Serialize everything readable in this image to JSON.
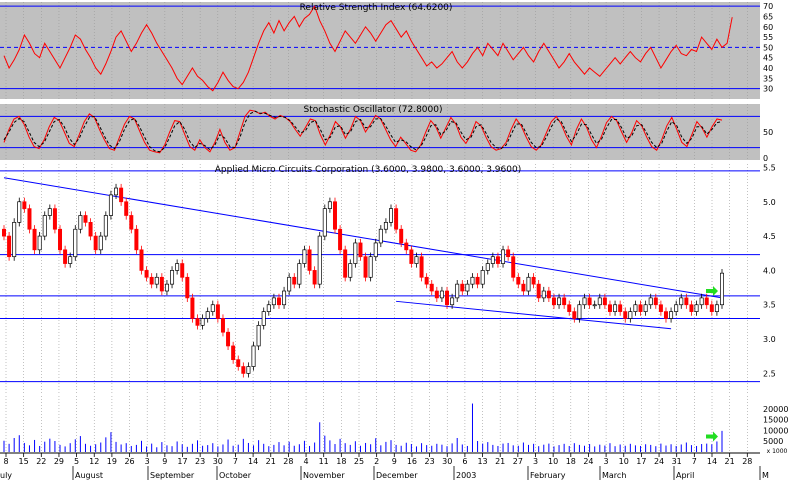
{
  "colors": {
    "background": "#ffffff",
    "rsi_panel_bg": "#c0c0c0",
    "stoch_panel_bg": "#c0c0c0",
    "blue_line": "#0000ff",
    "red": "#ff0000",
    "black": "#000000",
    "green_arrow": "#22dd22",
    "grid": "#999999",
    "volume_bar": "#0000ff"
  },
  "chart_data": [
    {
      "type": "line",
      "title": "Relative Strength Index (64.6200)",
      "ylim": [
        25,
        72
      ],
      "y_ticks": [
        "70",
        "65",
        "60",
        "55",
        "50",
        "45",
        "40",
        "35",
        "30"
      ],
      "y_tick_values": [
        70,
        65,
        60,
        55,
        50,
        45,
        40,
        35,
        30
      ],
      "reference_lines": [
        70,
        50,
        30
      ],
      "series": [
        {
          "color": "red",
          "values": [
            46,
            40,
            44,
            49,
            56,
            52,
            47,
            45,
            52,
            48,
            44,
            40,
            45,
            50,
            56,
            54,
            49,
            45,
            40,
            37,
            42,
            48,
            55,
            58,
            53,
            48,
            52,
            57,
            61,
            57,
            52,
            48,
            44,
            40,
            35,
            32,
            36,
            40,
            36,
            34,
            31,
            29,
            33,
            38,
            34,
            31,
            30,
            33,
            38,
            45,
            52,
            58,
            62,
            57,
            63,
            58,
            62,
            65,
            60,
            64,
            66,
            70,
            63,
            58,
            52,
            48,
            53,
            58,
            55,
            52,
            56,
            60,
            57,
            53,
            57,
            61,
            63,
            59,
            55,
            58,
            53,
            49,
            45,
            41,
            43,
            40,
            42,
            45,
            48,
            43,
            40,
            43,
            47,
            50,
            46,
            52,
            49,
            46,
            52,
            48,
            44,
            47,
            50,
            46,
            43,
            48,
            52,
            48,
            44,
            40,
            43,
            47,
            43,
            40,
            37,
            40,
            38,
            36,
            39,
            42,
            45,
            42,
            45,
            48,
            45,
            43,
            47,
            50,
            45,
            40,
            44,
            48,
            51,
            47,
            46,
            49,
            48,
            55,
            52,
            49,
            54,
            50,
            52,
            64.62
          ]
        }
      ]
    },
    {
      "type": "line",
      "title": "Stochastic Oscillator (72.8000)",
      "ylim": [
        0,
        100
      ],
      "y_ticks": [
        "50",
        "0"
      ],
      "y_tick_values": [
        50,
        0
      ],
      "reference_lines": [
        80,
        20
      ],
      "series": [
        {
          "color": "red",
          "values": [
            30,
            55,
            75,
            80,
            65,
            40,
            22,
            18,
            35,
            60,
            78,
            72,
            50,
            28,
            22,
            45,
            70,
            85,
            78,
            55,
            35,
            18,
            15,
            40,
            65,
            80,
            75,
            52,
            30,
            15,
            12,
            10,
            25,
            50,
            72,
            70,
            45,
            22,
            15,
            35,
            20,
            12,
            30,
            55,
            30,
            15,
            20,
            50,
            80,
            92,
            90,
            85,
            88,
            80,
            75,
            82,
            78,
            70,
            55,
            42,
            58,
            75,
            72,
            45,
            25,
            45,
            70,
            60,
            38,
            55,
            80,
            72,
            50,
            65,
            82,
            75,
            55,
            35,
            22,
            40,
            28,
            15,
            12,
            25,
            50,
            72,
            60,
            38,
            58,
            78,
            65,
            40,
            28,
            45,
            70,
            62,
            40,
            22,
            15,
            18,
            30,
            55,
            75,
            62,
            40,
            22,
            15,
            25,
            48,
            70,
            80,
            65,
            42,
            25,
            55,
            75,
            60,
            35,
            20,
            42,
            68,
            80,
            72,
            50,
            30,
            48,
            72,
            62,
            40,
            22,
            15,
            35,
            62,
            78,
            55,
            30,
            22,
            45,
            70,
            58,
            40,
            60,
            75,
            72.8
          ]
        },
        {
          "color": "black-dashed",
          "values": [
            35,
            50,
            68,
            76,
            70,
            50,
            30,
            22,
            30,
            50,
            70,
            74,
            60,
            38,
            26,
            38,
            60,
            78,
            80,
            62,
            42,
            25,
            18,
            32,
            55,
            72,
            76,
            60,
            40,
            22,
            14,
            12,
            20,
            40,
            62,
            70,
            55,
            32,
            20,
            28,
            24,
            16,
            25,
            45,
            38,
            22,
            20,
            40,
            68,
            85,
            90,
            86,
            86,
            82,
            78,
            80,
            78,
            72,
            60,
            48,
            52,
            68,
            72,
            55,
            35,
            40,
            60,
            62,
            45,
            50,
            70,
            74,
            58,
            60,
            75,
            76,
            62,
            45,
            30,
            35,
            32,
            22,
            16,
            22,
            40,
            62,
            64,
            45,
            52,
            70,
            68,
            50,
            35,
            40,
            60,
            64,
            48,
            30,
            20,
            18,
            25,
            45,
            65,
            66,
            48,
            30,
            20,
            22,
            40,
            60,
            75,
            70,
            50,
            32,
            45,
            65,
            64,
            45,
            28,
            36,
            58,
            74,
            74,
            58,
            38,
            42,
            62,
            64,
            48,
            30,
            20,
            28,
            52,
            70,
            62,
            40,
            28,
            38,
            60,
            60,
            46,
            55,
            68,
            70
          ]
        }
      ]
    },
    {
      "type": "candlestick",
      "title": "Applied Micro Circuits Corporation (3.6000, 3.9800, 3.6000, 3.9600)",
      "ylim": [
        2.2,
        5.55
      ],
      "y_ticks": [
        "5.5",
        "5.0",
        "4.5",
        "4.0",
        "3.5",
        "3.0",
        "2.5"
      ],
      "y_tick_values": [
        5.5,
        5.0,
        4.5,
        4.0,
        3.5,
        3.0,
        2.5
      ],
      "horizontal_lines": [
        5.45,
        4.23,
        3.63,
        3.3,
        2.38
      ],
      "trend_lines": [
        {
          "from": [
            0,
            5.35
          ],
          "to": [
            141,
            3.6
          ]
        },
        {
          "from": [
            77,
            3.55
          ],
          "to": [
            131,
            3.15
          ]
        }
      ],
      "close": [
        4.5,
        4.2,
        4.7,
        5.0,
        4.9,
        4.6,
        4.3,
        4.5,
        4.8,
        4.9,
        4.6,
        4.3,
        4.1,
        4.2,
        4.6,
        4.8,
        4.7,
        4.5,
        4.3,
        4.5,
        4.8,
        5.1,
        5.2,
        5.0,
        4.8,
        4.6,
        4.3,
        4.0,
        3.9,
        3.8,
        3.9,
        3.7,
        3.8,
        4.0,
        4.1,
        3.9,
        3.6,
        3.3,
        3.2,
        3.3,
        3.4,
        3.5,
        3.3,
        3.1,
        2.9,
        2.7,
        2.6,
        2.5,
        2.6,
        2.9,
        3.2,
        3.4,
        3.5,
        3.6,
        3.5,
        3.7,
        3.9,
        3.8,
        4.1,
        4.3,
        4.0,
        3.8,
        4.5,
        4.9,
        5.0,
        4.6,
        4.3,
        3.9,
        4.1,
        4.4,
        4.2,
        3.9,
        4.2,
        4.4,
        4.6,
        4.7,
        4.9,
        4.6,
        4.4,
        4.3,
        4.1,
        4.2,
        3.9,
        3.8,
        3.7,
        3.6,
        3.7,
        3.5,
        3.6,
        3.8,
        3.7,
        3.8,
        3.9,
        3.8,
        4.0,
        4.1,
        4.2,
        4.1,
        4.3,
        4.2,
        3.9,
        3.8,
        3.7,
        3.9,
        3.8,
        3.6,
        3.7,
        3.6,
        3.5,
        3.6,
        3.5,
        3.4,
        3.3,
        3.5,
        3.6,
        3.5,
        3.5,
        3.6,
        3.5,
        3.4,
        3.5,
        3.4,
        3.3,
        3.4,
        3.5,
        3.4,
        3.5,
        3.6,
        3.5,
        3.4,
        3.3,
        3.4,
        3.5,
        3.6,
        3.5,
        3.4,
        3.5,
        3.6,
        3.5,
        3.4,
        3.5,
        3.96
      ]
    },
    {
      "type": "bar",
      "title": "",
      "y_ticks": [
        "20000",
        "15000",
        "10000",
        "5000"
      ],
      "y_tick_values": [
        20000,
        15000,
        10000,
        5000
      ],
      "y_unit_label": "x 1000",
      "ylim": [
        0,
        26000
      ],
      "values": [
        5200,
        3800,
        6500,
        7800,
        4200,
        3100,
        5600,
        2800,
        4800,
        6200,
        5100,
        3300,
        2600,
        4100,
        5900,
        7400,
        3800,
        2900,
        3600,
        4400,
        6800,
        9200,
        4700,
        3500,
        4100,
        2800,
        3300,
        5200,
        2600,
        3900,
        2200,
        4600,
        3100,
        2700,
        4900,
        3600,
        2400,
        3800,
        5400,
        2900,
        3200,
        4100,
        2600,
        3500,
        5800,
        2900,
        3400,
        6100,
        4200,
        3100,
        5500,
        3800,
        2700,
        3300,
        4600,
        3100,
        4800,
        2900,
        3600,
        5200,
        2800,
        4400,
        13800,
        7600,
        5400,
        3700,
        6100,
        4100,
        3300,
        5000,
        2900,
        4200,
        3600,
        6400,
        3100,
        4700,
        5500,
        3300,
        2900,
        4300,
        3700,
        2600,
        4100,
        3200,
        2900,
        3800,
        3400,
        2700,
        4000,
        6500,
        3500,
        2800,
        22500,
        5100,
        3900,
        4600,
        3300,
        2800,
        3900,
        4200,
        3100,
        2900,
        4400,
        3300,
        3800,
        2700,
        3400,
        3900,
        2600,
        3200,
        3800,
        2800,
        4100,
        3300,
        2900,
        3700,
        2600,
        3400,
        3000,
        4100,
        2700,
        3500,
        2900,
        3800,
        3100,
        2800,
        3600,
        3300,
        2700,
        3900,
        3000,
        3600,
        2800,
        3500,
        4400,
        3200,
        2800,
        3700,
        3900,
        3600,
        4900,
        9800
      ]
    }
  ],
  "x_axis": {
    "day_labels": [
      "8",
      "15",
      "22",
      "29",
      "5",
      "12",
      "19",
      "26",
      "3",
      "9",
      "17",
      "23",
      "30",
      "7",
      "14",
      "21",
      "28",
      "4",
      "11",
      "18",
      "25",
      "2",
      "9",
      "16",
      "23",
      "30",
      "6",
      "13",
      "21",
      "27",
      "3",
      "10",
      "18",
      "24",
      "3",
      "10",
      "17",
      "24",
      "31",
      "7",
      "14",
      "21",
      "28"
    ],
    "month_labels": [
      "uly",
      "August",
      "September",
      "October",
      "November",
      "December",
      "2003",
      "February",
      "March",
      "April",
      "M"
    ]
  },
  "annotations": {
    "arrow_candle_price": 3.7,
    "arrow_volume_value": 7200
  }
}
